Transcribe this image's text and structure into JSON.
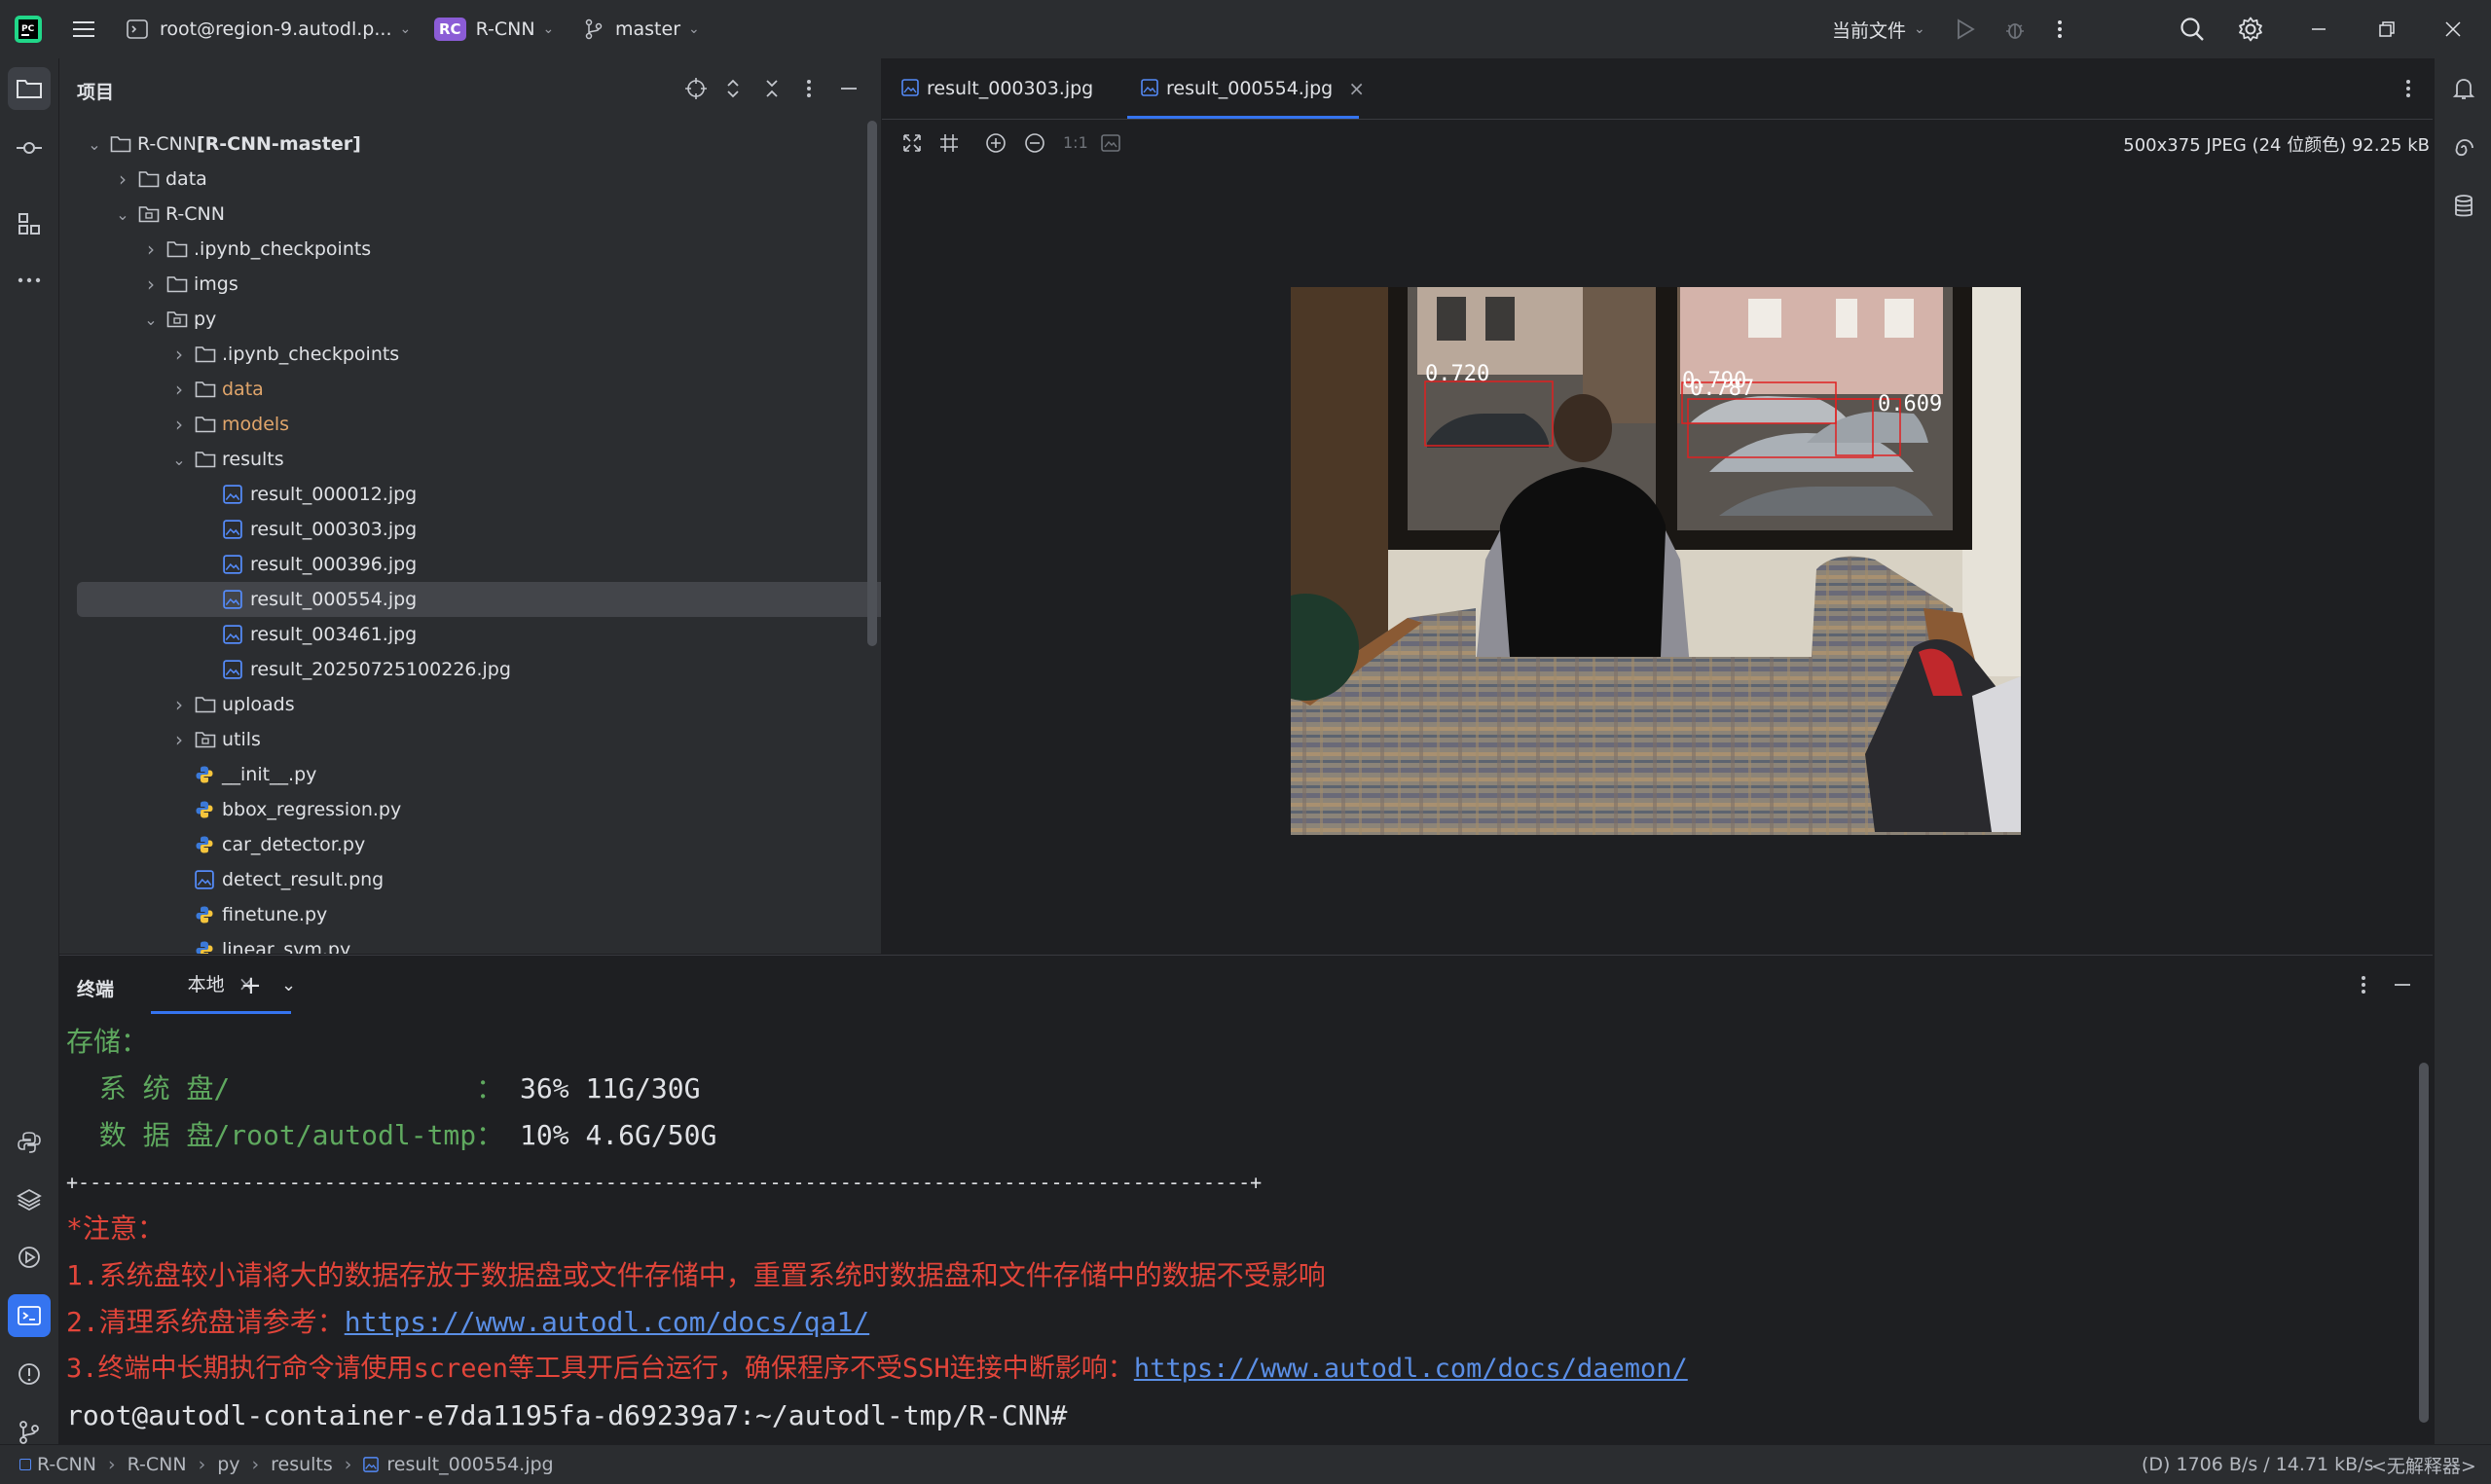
{
  "titlebar": {
    "remote": "root@region-9.autodl.p...",
    "project_badge": "RC",
    "project": "R-CNN",
    "branch": "master",
    "run_config": "当前文件"
  },
  "project_panel": {
    "title": "项目",
    "tree": [
      {
        "label": "R-CNN",
        "extra": "[R-CNN-master]",
        "kind": "folder"
      },
      {
        "label": "data",
        "kind": "folder"
      },
      {
        "label": "R-CNN",
        "kind": "module"
      },
      {
        "label": ".ipynb_checkpoints",
        "kind": "folder"
      },
      {
        "label": "imgs",
        "kind": "folder"
      },
      {
        "label": "py",
        "kind": "module"
      },
      {
        "label": ".ipynb_checkpoints",
        "kind": "folder"
      },
      {
        "label": "data",
        "kind": "folder-excluded"
      },
      {
        "label": "models",
        "kind": "folder-excluded"
      },
      {
        "label": "results",
        "kind": "folder"
      },
      {
        "label": "result_000012.jpg",
        "kind": "image"
      },
      {
        "label": "result_000303.jpg",
        "kind": "image"
      },
      {
        "label": "result_000396.jpg",
        "kind": "image"
      },
      {
        "label": "result_000554.jpg",
        "kind": "image",
        "selected": true
      },
      {
        "label": "result_003461.jpg",
        "kind": "image"
      },
      {
        "label": "result_20250725100226.jpg",
        "kind": "image"
      },
      {
        "label": "uploads",
        "kind": "folder"
      },
      {
        "label": "utils",
        "kind": "module"
      },
      {
        "label": "__init__.py",
        "kind": "python"
      },
      {
        "label": "bbox_regression.py",
        "kind": "python"
      },
      {
        "label": "car_detector.py",
        "kind": "python"
      },
      {
        "label": "detect_result.png",
        "kind": "image"
      },
      {
        "label": "finetune.py",
        "kind": "python"
      },
      {
        "label": "linear_svm.py",
        "kind": "python"
      }
    ]
  },
  "editor": {
    "tabs": [
      {
        "label": "result_000303.jpg",
        "active": false
      },
      {
        "label": "result_000554.jpg",
        "active": true
      }
    ],
    "zoom_actual": "1:1",
    "image_info": "500x375 JPEG (24 位颜色) 92.25 kB",
    "detections": [
      {
        "score": "0.720"
      },
      {
        "score": "0.790"
      },
      {
        "score": "0.787"
      },
      {
        "score": "0.609"
      }
    ]
  },
  "terminal": {
    "title": "终端",
    "tab": "本地",
    "lines": {
      "storage_label": "存储：",
      "sys_disk_label": "  系 统 盘/               ：",
      "sys_disk_value": " 36% 11G/30G",
      "data_disk_label": "  数 据 盘/root/autodl-tmp：",
      "data_disk_value": " 10% 4.6G/50G",
      "separator": "+----------------------------------------------------------------------------------------------------+",
      "notice": "*注意：",
      "note1": "1.系统盘较小请将大的数据存放于数据盘或文件存储中，重置系统时数据盘和文件存储中的数据不受影响",
      "note2_text": "2.清理系统盘请参考：",
      "note2_link": "https://www.autodl.com/docs/qa1/",
      "note3_text": "3.终端中长期执行命令请使用screen等工具开后台运行，确保程序不受SSH连接中断影响：",
      "note3_link": "https://www.autodl.com/docs/daemon/",
      "prompt": "root@autodl-container-e7da1195fa-d69239a7:~/autodl-tmp/R-CNN#"
    }
  },
  "statusbar": {
    "breadcrumbs": [
      "R-CNN",
      "R-CNN",
      "py",
      "results",
      "result_000554.jpg"
    ],
    "io": "(D) 1706 B/s / 14.71 kB/s",
    "interpreter": "<无解释器>"
  },
  "colors": {
    "accent": "#3574f0",
    "excluded_folder": "#e0a56b",
    "terminal_green": "#5fa95f",
    "terminal_red": "#e2453a",
    "link": "#5b8fe6",
    "detection_box": "#e02020"
  }
}
